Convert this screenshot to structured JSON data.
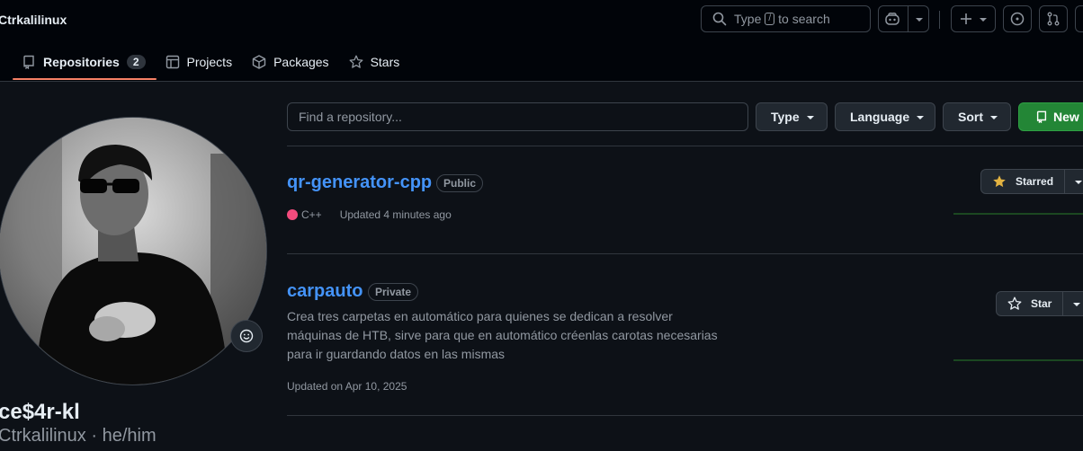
{
  "header": {
    "username": "Ctrkalilinux",
    "search": {
      "prefix": "Type",
      "key": "/",
      "suffix": "to search"
    }
  },
  "tabs": [
    {
      "label": "Repositories",
      "count": "2",
      "icon": "repo-icon"
    },
    {
      "label": "Projects",
      "icon": "table-icon"
    },
    {
      "label": "Packages",
      "icon": "package-icon"
    },
    {
      "label": "Stars",
      "icon": "star-icon"
    }
  ],
  "profile": {
    "name": "ce$4r-kl",
    "login": "Ctrkalilinux",
    "pronouns": "he/him",
    "separator": "·"
  },
  "filters": {
    "find_placeholder": "Find a repository...",
    "type_label": "Type",
    "language_label": "Language",
    "sort_label": "Sort",
    "new_label": "New"
  },
  "repos": [
    {
      "name": "qr-generator-cpp",
      "visibility": "Public",
      "language": "C++",
      "language_color": "#f34b7d",
      "updated": "Updated 4 minutes ago",
      "star_label": "Starred",
      "starred": true
    },
    {
      "name": "carpauto",
      "visibility": "Private",
      "description": "Crea tres carpetas en automático para quienes se dedican a resolver máquinas de HTB, sirve para que en automático créenlas carotas necesarias para ir guardando datos en las mismas",
      "updated": "Updated on Apr 10, 2025",
      "star_label": "Star",
      "starred": false
    }
  ],
  "colors": {
    "background": "#0d1117",
    "accent_link": "#4493f8",
    "tab_underline": "#f78166",
    "new_button": "#238636",
    "starred_icon": "#e3b341"
  }
}
